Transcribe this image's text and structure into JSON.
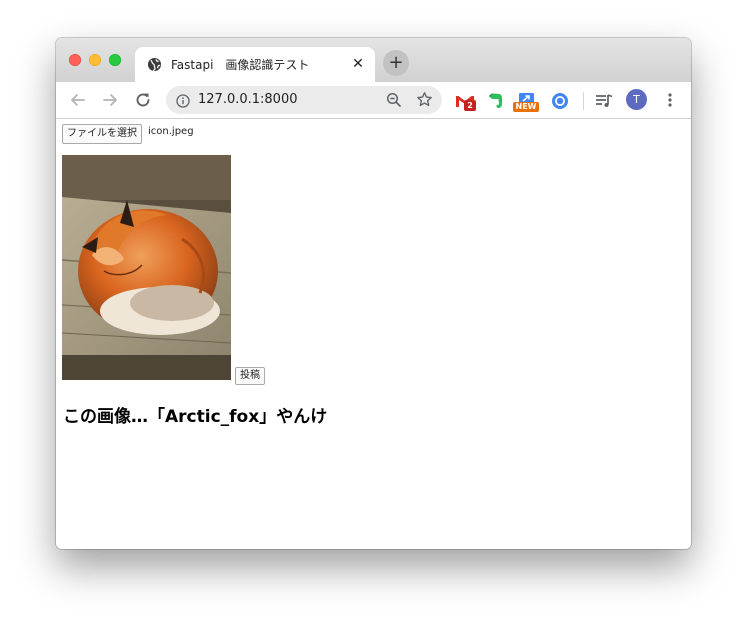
{
  "browser": {
    "tab": {
      "title": "Fastapi　画像認識テスト",
      "favicon": "globe-icon",
      "close_symbol": "✕"
    },
    "new_tab_symbol": "+",
    "toolbar": {
      "url": "127.0.0.1:8000",
      "profile_initial": "T",
      "extensions": [
        {
          "name": "gmail-icon",
          "badge": "2"
        },
        {
          "name": "evernote-icon",
          "badge": ""
        },
        {
          "name": "new-extension-icon",
          "badge": "NEW"
        },
        {
          "name": "chrome-remote-icon",
          "badge": ""
        }
      ]
    }
  },
  "page": {
    "file_button_label": "ファイルを選択",
    "file_name": "icon.jpeg",
    "submit_label": "投稿",
    "result_text": "この画像…「Arctic_fox」やんけ",
    "image_alt": "Sleeping red fox curled up on a wooden board"
  }
}
